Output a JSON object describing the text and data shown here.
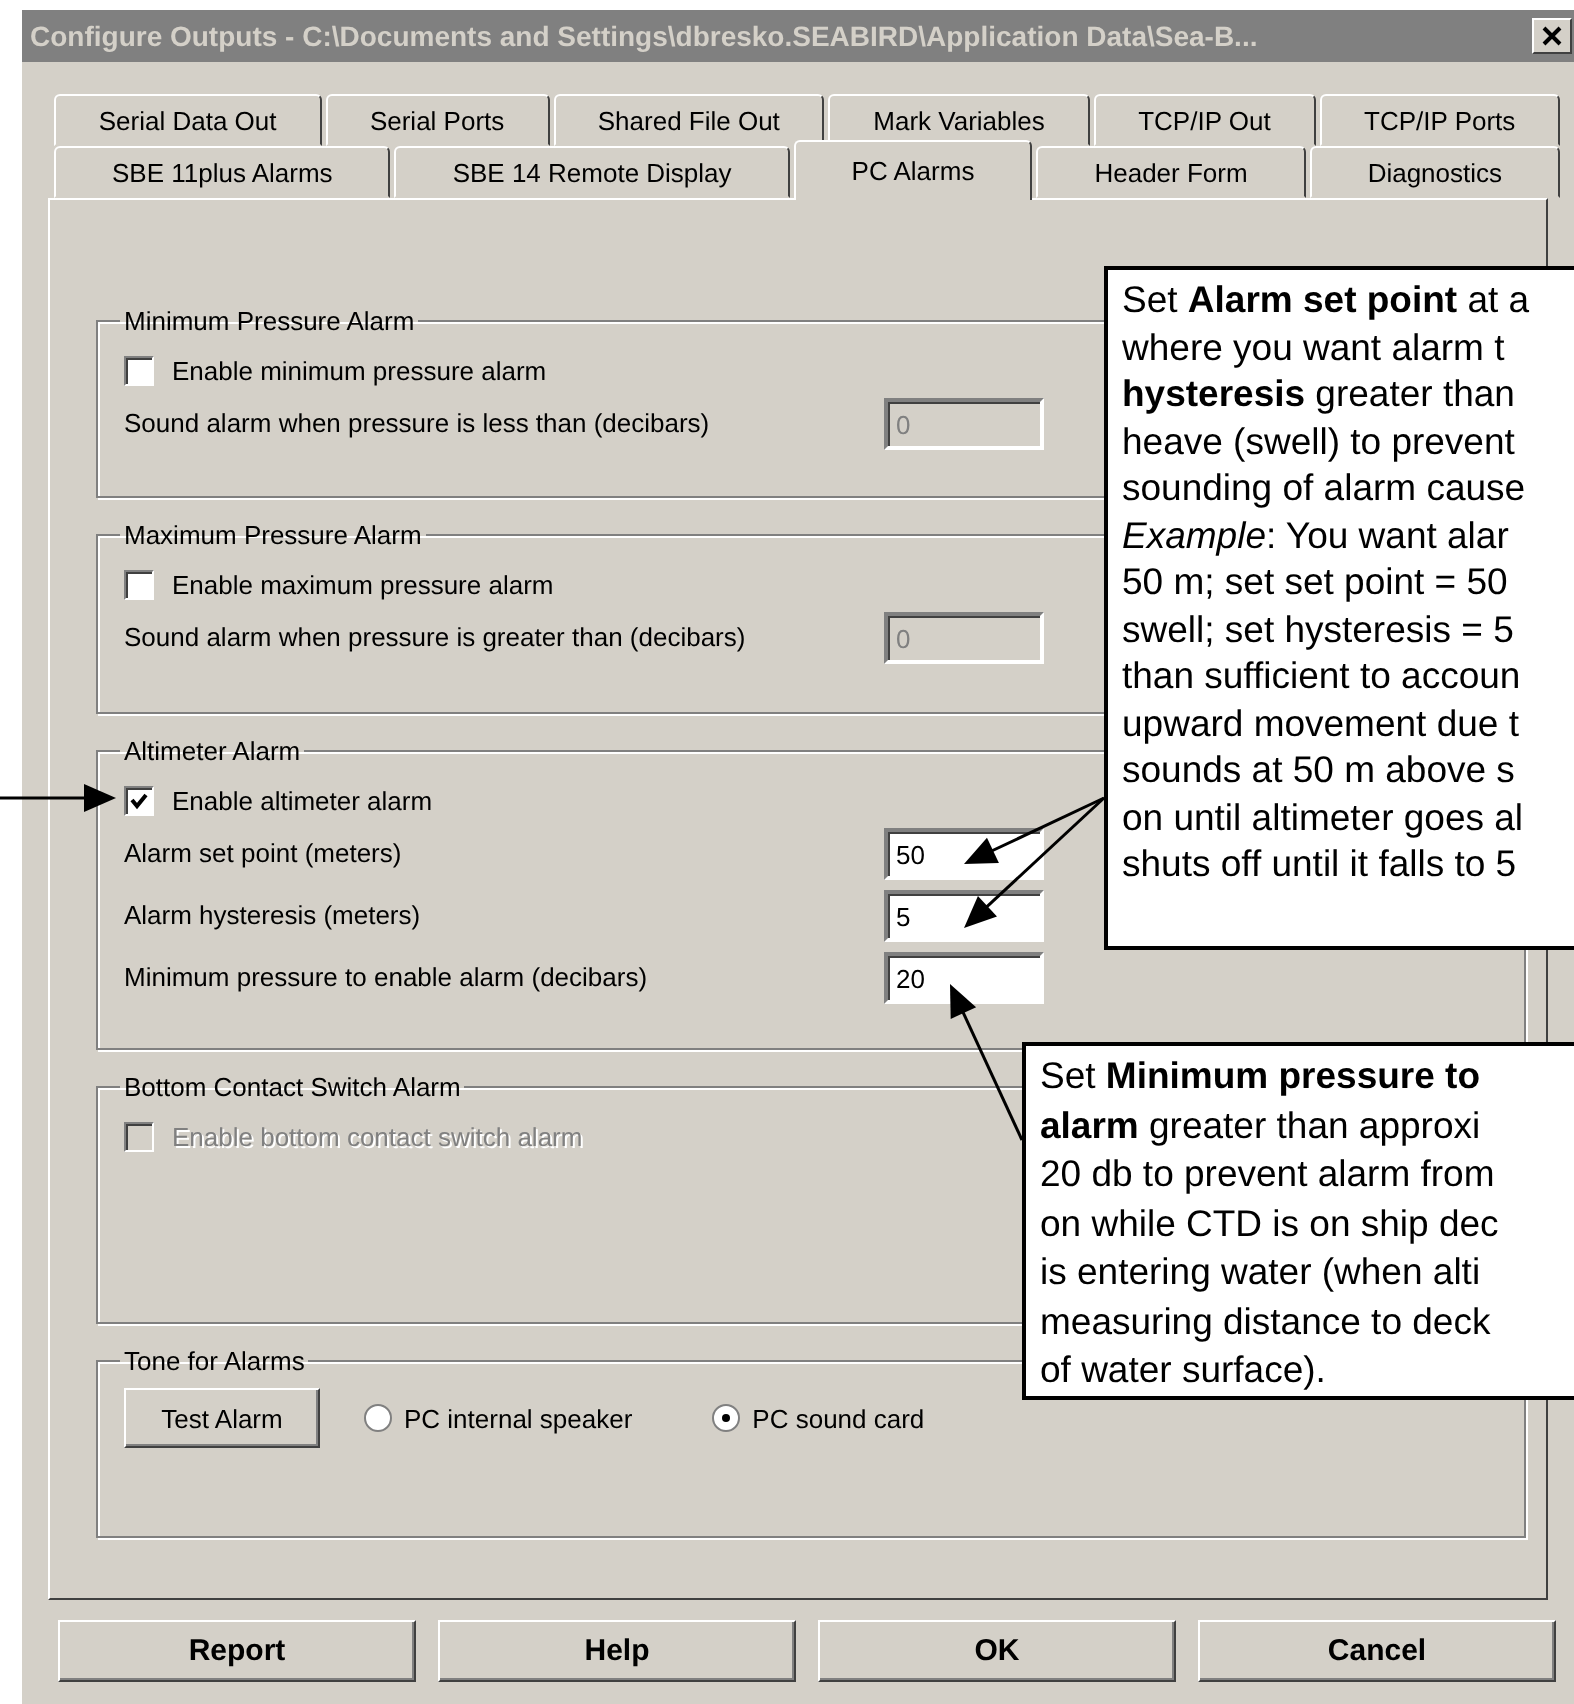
{
  "window": {
    "title": "Configure Outputs - C:\\Documents and Settings\\dbresko.SEABIRD\\Application Data\\Sea-B..."
  },
  "tab_rows": [
    [
      {
        "label": "Serial Data Out",
        "selected": false
      },
      {
        "label": "Serial Ports",
        "selected": false
      },
      {
        "label": "Shared File Out",
        "selected": false
      },
      {
        "label": "Mark Variables",
        "selected": false
      },
      {
        "label": "TCP/IP Out",
        "selected": false
      },
      {
        "label": "TCP/IP Ports",
        "selected": false
      }
    ],
    [
      {
        "label": "SBE 11plus Alarms",
        "selected": false
      },
      {
        "label": "SBE 14 Remote Display",
        "selected": false
      },
      {
        "label": "PC Alarms",
        "selected": true
      },
      {
        "label": "Header Form",
        "selected": false
      },
      {
        "label": "Diagnostics",
        "selected": false
      }
    ]
  ],
  "groups": [
    {
      "kind": "settings",
      "title": "Minimum Pressure Alarm",
      "checkbox": {
        "label": "Enable minimum pressure alarm",
        "checked": false,
        "disabled": false
      },
      "fields": [
        {
          "label": "Sound alarm when pressure is less than (decibars)",
          "value": "0",
          "disabled": true
        }
      ]
    },
    {
      "kind": "settings",
      "title": "Maximum Pressure Alarm",
      "checkbox": {
        "label": "Enable maximum pressure alarm",
        "checked": false,
        "disabled": false
      },
      "fields": [
        {
          "label": "Sound alarm when pressure is greater than (decibars)",
          "value": "0",
          "disabled": true
        }
      ]
    },
    {
      "kind": "settings",
      "title": "Altimeter Alarm",
      "checkbox": {
        "label": "Enable altimeter alarm",
        "checked": true,
        "disabled": false
      },
      "fields": [
        {
          "label": "Alarm set point (meters)",
          "value": "50",
          "disabled": false
        },
        {
          "label": "Alarm hysteresis (meters)",
          "value": "5",
          "disabled": false
        },
        {
          "label": "Minimum pressure to enable alarm (decibars)",
          "value": "20",
          "disabled": false
        }
      ]
    },
    {
      "kind": "settings",
      "title": "Bottom Contact Switch Alarm",
      "checkbox": {
        "label": "Enable bottom contact switch alarm",
        "checked": false,
        "disabled": true
      }
    },
    {
      "kind": "tone",
      "title": "Tone for Alarms",
      "button": "Test Alarm",
      "radios": [
        {
          "label": "PC internal speaker",
          "selected": false
        },
        {
          "label": "PC sound card",
          "selected": true
        }
      ]
    }
  ],
  "buttons": [
    "Report",
    "Help",
    "OK",
    "Cancel"
  ],
  "callouts": [
    {
      "lines": [
        "Set **Alarm set point** at a",
        "where you want alarm t",
        "**hysteresis** greater than",
        "heave (swell) to prevent",
        "sounding of alarm cause",
        "*Example*: You want alar",
        "50 m; set set point = 50",
        "swell; set hysteresis = 5",
        "than sufficient to accoun",
        "upward movement due t",
        "sounds at 50 m above s",
        "on until altimeter goes al",
        "shuts off until it falls to 5"
      ]
    },
    {
      "lines": [
        "Set **Minimum pressure to**",
        "**alarm** greater than approxi",
        "20 db to prevent alarm from",
        "on while CTD is on ship dec",
        "is entering water (when alti",
        "measuring distance to deck",
        "of water surface)."
      ]
    }
  ]
}
